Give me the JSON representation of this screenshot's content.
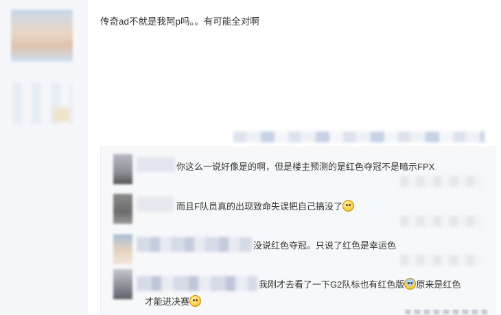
{
  "post": {
    "text": "传奇ad不就是我阿p吗。。有可能全对啊"
  },
  "replies": [
    {
      "text": "你这么一说好像是的啊，但是楼主预测的是红色夺冠不是暗示FPX",
      "emoji": ""
    },
    {
      "text": "而且F队员真的出现致命失误把自己搞没了",
      "emoji": "angry-emoji"
    },
    {
      "text": "没说红色夺冠。只说了红色是幸运色",
      "emoji": ""
    },
    {
      "text_before": "我刚才去看了一下G2队标也有红色版",
      "emoji": "fear-emoji",
      "text_after": "原来是红色",
      "text_line2": "才能进决赛",
      "emoji2": "laugh-emoji"
    }
  ],
  "colors": {
    "page_bg": "#ffffff",
    "left_column_bg": "#f5f7fa",
    "reply_panel_bg": "#f7f8fa",
    "text": "#333333"
  }
}
